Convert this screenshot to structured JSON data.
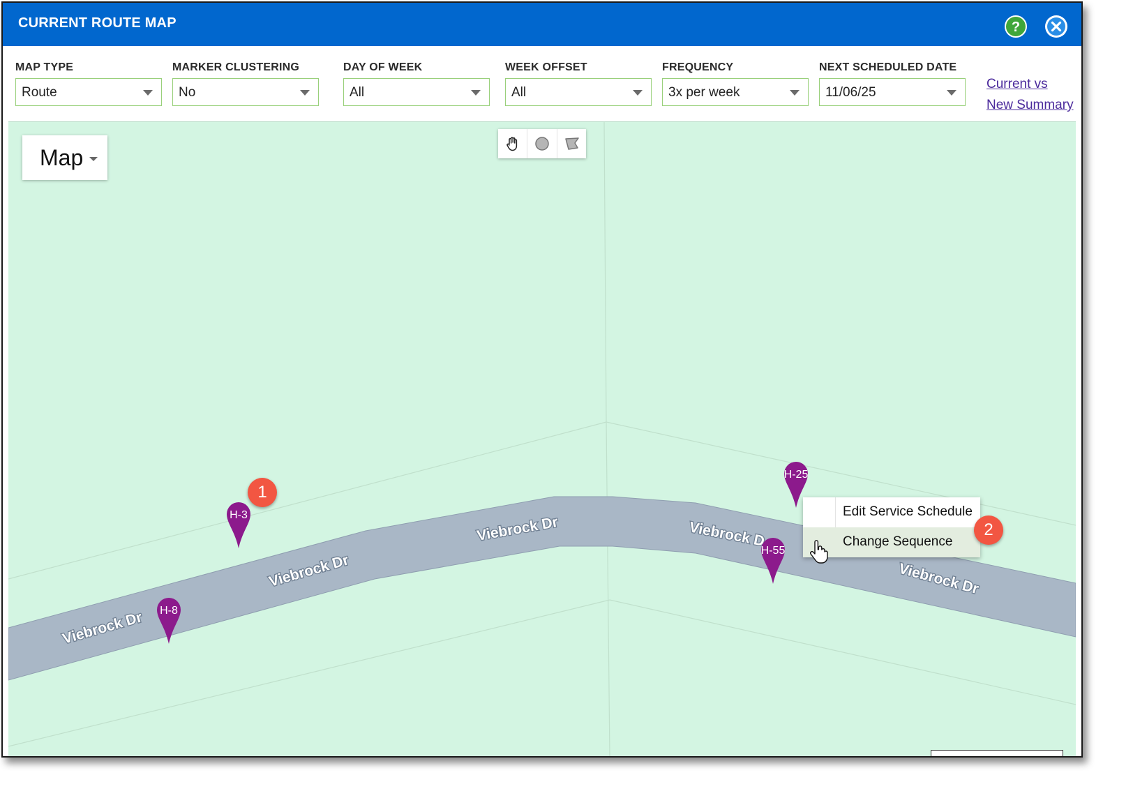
{
  "window": {
    "title": "CURRENT ROUTE MAP",
    "help_label": "?"
  },
  "filters": [
    {
      "label": "MAP TYPE",
      "value": "Route"
    },
    {
      "label": "MARKER CLUSTERING",
      "value": "No"
    },
    {
      "label": "DAY OF WEEK",
      "value": "All"
    },
    {
      "label": "WEEK OFFSET",
      "value": "All"
    },
    {
      "label": "FREQUENCY",
      "value": "3x per week"
    },
    {
      "label": "NEXT SCHEDULED DATE",
      "value": "11/06/25"
    }
  ],
  "summary_link": {
    "line1": "Current vs",
    "line2": "New Summary"
  },
  "map": {
    "map_type_label": "Map",
    "draw_tools": [
      "hand-icon",
      "circle-icon",
      "polygon-icon"
    ],
    "street_name": "Viebrock Dr",
    "street_labels": [
      "Viebrock Dr",
      "Viebrock Dr",
      "Viebrock Dr",
      "Viebrock D",
      "Viebrock Dr"
    ],
    "markers": [
      "H-3",
      "H-8",
      "H-25",
      "H-55"
    ],
    "marker_color": "#8c1a8c",
    "road_color": "#a9b7c6",
    "background_color": "#d3f5e2"
  },
  "context_menu": {
    "items": [
      "Edit Service Schedule",
      "Change Sequence"
    ],
    "highlighted": "Change Sequence"
  },
  "callouts": [
    "1",
    "2"
  ],
  "colors": {
    "titlebar": "#0167ce",
    "callout": "#f25642",
    "link": "#4b2a9c"
  }
}
